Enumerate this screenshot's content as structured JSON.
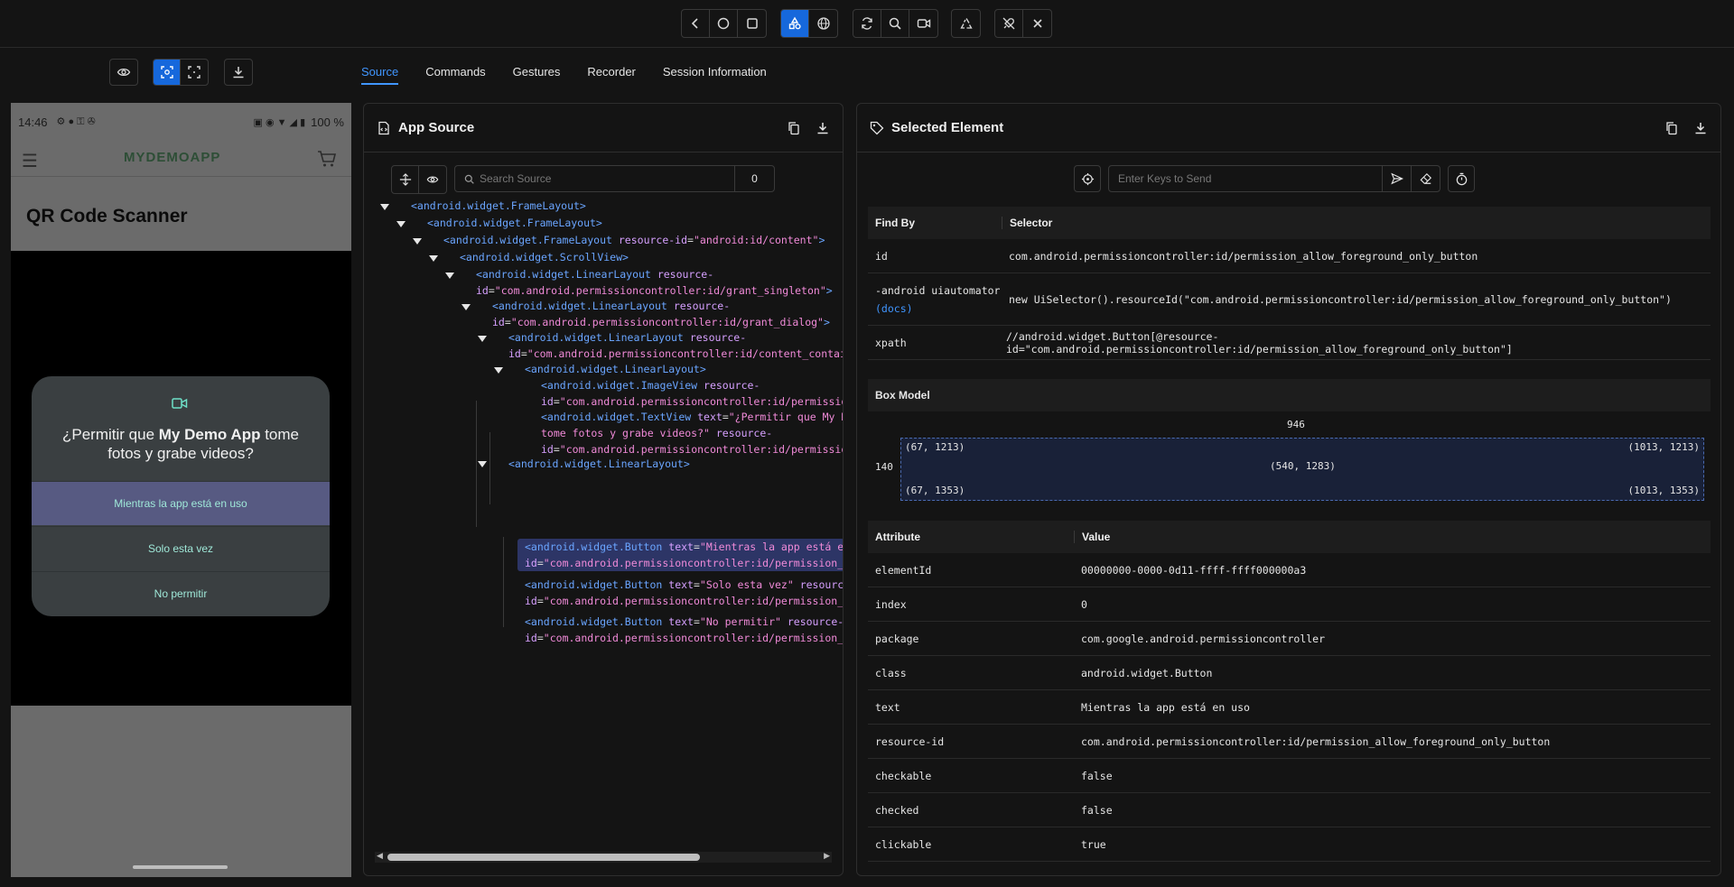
{
  "phone": {
    "time": "14:46",
    "battery": "100 %",
    "app_logo": "MYDEMOAPP",
    "screen_title": "QR Code Scanner",
    "dialog": {
      "question_prefix": "¿Permitir que ",
      "question_app": "My Demo App",
      "question_suffix": " tome",
      "question_line2": "fotos y grabe videos?",
      "options": [
        "Mientras la app está en uso",
        "Solo esta vez",
        "No permitir"
      ]
    }
  },
  "tabs": [
    "Source",
    "Commands",
    "Gestures",
    "Recorder",
    "Session Information"
  ],
  "source": {
    "title": "App Source",
    "search_placeholder": "Search Source",
    "search_count": "0",
    "tree": [
      {
        "tag": "<android.widget.FrameLayout>"
      },
      {
        "tag": "<android.widget.FrameLayout>"
      },
      {
        "tag": "<android.widget.FrameLayout",
        "attr": "resource-id",
        "val": "\"android:id/content\"",
        "end": ">"
      },
      {
        "tag": "<android.widget.ScrollView>"
      },
      {
        "tag": "<android.widget.LinearLayout",
        "attr": "resource-",
        "line2_attr": "id",
        "line2_val": "\"com.android.permissioncontroller:id/grant_singleton\"",
        "end": ">"
      },
      {
        "tag": "<android.widget.LinearLayout",
        "attr": "resource-",
        "line2_attr": "id",
        "line2_val": "\"com.android.permissioncontroller:id/grant_dialog\"",
        "end": ">"
      },
      {
        "tag": "<android.widget.LinearLayout",
        "attr": "resource-",
        "line2_attr": "id",
        "line2_val": "\"com.android.permissioncontroller:id/content_contai"
      },
      {
        "tag": "<android.widget.LinearLayout>"
      },
      {
        "tag": "<android.widget.ImageView",
        "attr": "resource-",
        "line2_attr": "id",
        "line2_val": "\"com.android.permissioncontroller:id/permissio"
      },
      {
        "tag": "<android.widget.TextView",
        "attr": "text",
        "val": "\"¿Permitir que My D",
        "line2_text": "tome fotos y grabe videos?\"",
        "line2_attr2": "resource-",
        "line3_attr": "id",
        "line3_val": "\"com.android.permissioncontroller:id/permissio"
      },
      {
        "tag": "<android.widget.LinearLayout>"
      },
      {
        "tag": "<android.widget.Button",
        "attr": "text",
        "val": "\"Mientras la app está en",
        "line2_attr": "id",
        "line2_val": "\"com.android.permissioncontroller:id/permission_a"
      },
      {
        "tag": "<android.widget.Button",
        "attr": "text",
        "val": "\"Solo esta vez\"",
        "attr2": "resource",
        "line2_attr": "id",
        "line2_val": "\"com.android.permissioncontroller:id/permission_a"
      },
      {
        "tag": "<android.widget.Button",
        "attr": "text",
        "val": "\"No permitir\"",
        "attr2": "resource-",
        "line2_attr": "id",
        "line2_val": "\"com.android.permissioncontroller:id/permission_c"
      }
    ]
  },
  "selected": {
    "title": "Selected Element",
    "keys_placeholder": "Enter Keys to Send",
    "findby_header": "Find By",
    "selector_header": "Selector",
    "findby": [
      {
        "by": "id",
        "sel": "com.android.permissioncontroller:id/permission_allow_foreground_only_button"
      },
      {
        "by": "-android uiautomator",
        "link": "(docs)",
        "sel": "new UiSelector().resourceId(\"com.android.permissioncontroller:id/permission_allow_foreground_only_button\")"
      },
      {
        "by": "xpath",
        "sel": "//android.widget.Button[@resource-id=\"com.android.permissioncontroller:id/permission_allow_foreground_only_button\"]"
      }
    ],
    "box_model": {
      "title": "Box Model",
      "width": "946",
      "height": "140",
      "tl": "(67, 1213)",
      "tr": "(1013, 1213)",
      "center": "(540, 1283)",
      "bl": "(67, 1353)",
      "br": "(1013, 1353)"
    },
    "attr_header": "Attribute",
    "value_header": "Value",
    "attributes": [
      {
        "k": "elementId",
        "v": "00000000-0000-0d11-ffff-ffff000000a3"
      },
      {
        "k": "index",
        "v": "0"
      },
      {
        "k": "package",
        "v": "com.google.android.permissioncontroller"
      },
      {
        "k": "class",
        "v": "android.widget.Button"
      },
      {
        "k": "text",
        "v": "Mientras la app está en uso"
      },
      {
        "k": "resource-id",
        "v": "com.android.permissioncontroller:id/permission_allow_foreground_only_button"
      },
      {
        "k": "checkable",
        "v": "false"
      },
      {
        "k": "checked",
        "v": "false"
      },
      {
        "k": "clickable",
        "v": "true"
      }
    ]
  }
}
